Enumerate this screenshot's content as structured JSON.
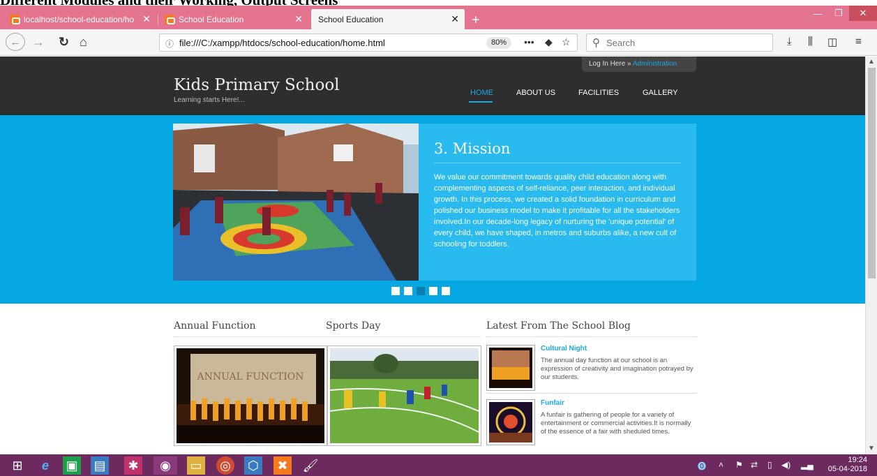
{
  "document": {
    "caption": "Different Modules and their Working, Output Screens"
  },
  "browser": {
    "tabs": [
      {
        "title": "localhost/school-education/ho",
        "active": false
      },
      {
        "title": "School Education",
        "active": false
      },
      {
        "title": "School Education",
        "active": true
      }
    ],
    "url": "file:///C:/xampp/htdocs/school-education/home.html",
    "zoom": "80%",
    "search_placeholder": "Search",
    "colors": {
      "tabbar": "#e3738f",
      "taskbar": "#6d2a5e"
    }
  },
  "site": {
    "login_prefix": "Log In Here »",
    "login_link": "Administration",
    "title": "Kids Primary School",
    "tagline": "Learning starts Here!...",
    "menu": [
      "HOME",
      "ABOUT US",
      "FACILITIES",
      "GALLERY"
    ],
    "active_menu": "HOME",
    "colors": {
      "header": "#2e2e2e",
      "accent": "#05a7e3",
      "link": "#1ea8e0"
    }
  },
  "hero": {
    "title": "3. Mission",
    "body": "We value our commitment towards quality child education along with complementing aspects of self-reliance, peer interaction, and individual growth. In this process, we created a solid foundation in curriculum and polished our business model to make it profitable for all the stakeholders involved.In our decade-long legacy of nurturing the 'unique potential' of every child, we have shaped, in metros and suburbs alike, a new cult of schooling for toddlers.",
    "slide_count": 5,
    "active_slide": 3
  },
  "sections": {
    "annual": {
      "title": "Annual Function",
      "image_text": "ANNUAL FUNCTION"
    },
    "sports": {
      "title": "Sports Day"
    },
    "blog": {
      "title": "Latest From The School Blog",
      "posts": [
        {
          "title": "Cultural Night",
          "body": "The annual day function at our school is an expression of creativity and imagination potrayed by our students."
        },
        {
          "title": "Funfair",
          "body": "A funfair is gathering of people for a variety of entertainment or commercial activities.It is normally of the essence of a fair with sheduled times."
        }
      ]
    }
  },
  "taskbar": {
    "time": "19:24",
    "date": "05-04-2018"
  }
}
